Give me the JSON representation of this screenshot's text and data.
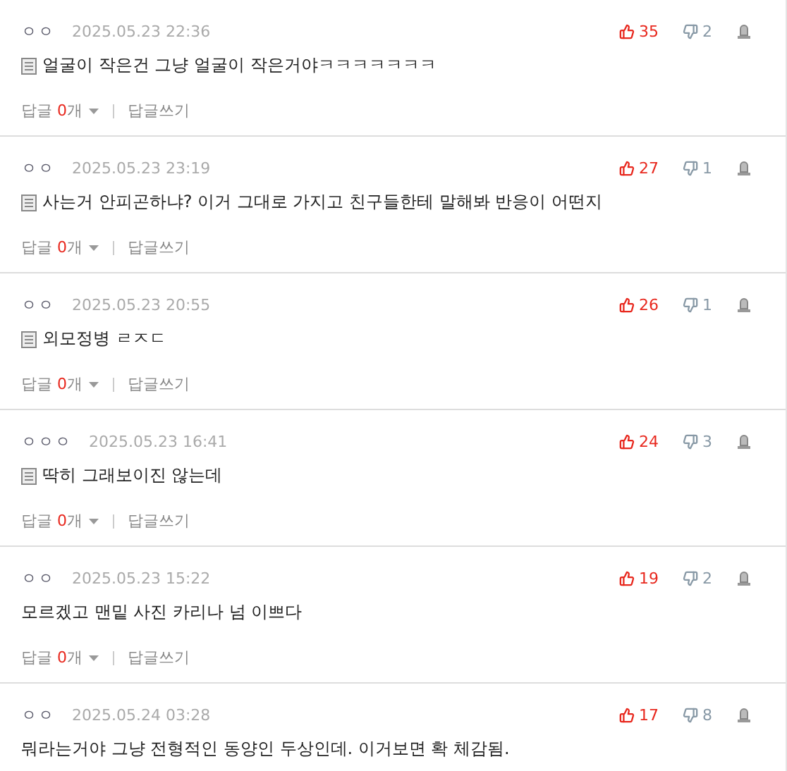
{
  "comments": [
    {
      "author": "ㅇㅇ",
      "date": "2025.05.23 22:36",
      "memo_icon": true,
      "text": "얼굴이 작은건 그냥 얼굴이 작은거야ㅋㅋㅋㅋㅋㅋㅋ",
      "likes": "35",
      "dislikes": "2",
      "reply": {
        "label": "답글",
        "count": "0",
        "unit": "개",
        "write": "답글쓰기"
      }
    },
    {
      "author": "ㅇㅇ",
      "date": "2025.05.23 23:19",
      "memo_icon": true,
      "text": "사는거 안피곤하냐? 이거 그대로 가지고 친구들한테 말해봐 반응이 어떤지",
      "likes": "27",
      "dislikes": "1",
      "reply": {
        "label": "답글",
        "count": "0",
        "unit": "개",
        "write": "답글쓰기"
      }
    },
    {
      "author": "ㅇㅇ",
      "date": "2025.05.23 20:55",
      "memo_icon": true,
      "text": "외모정병 ㄹㅈㄷ",
      "likes": "26",
      "dislikes": "1",
      "reply": {
        "label": "답글",
        "count": "0",
        "unit": "개",
        "write": "답글쓰기"
      }
    },
    {
      "author": "ㅇㅇㅇ",
      "date": "2025.05.23 16:41",
      "memo_icon": true,
      "text": "딱히 그래보이진 않는데",
      "likes": "24",
      "dislikes": "3",
      "reply": {
        "label": "답글",
        "count": "0",
        "unit": "개",
        "write": "답글쓰기"
      }
    },
    {
      "author": "ㅇㅇ",
      "date": "2025.05.23 15:22",
      "memo_icon": false,
      "text": "모르겠고 맨밑 사진 카리나 넘 이쁘다",
      "likes": "19",
      "dislikes": "2",
      "reply": {
        "label": "답글",
        "count": "0",
        "unit": "개",
        "write": "답글쓰기"
      }
    },
    {
      "author": "ㅇㅇ",
      "date": "2025.05.24 03:28",
      "memo_icon": false,
      "text": "뭐라는거야 그냥 전형적인 동양인 두상인데. 이거보면 확 체감됨.",
      "likes": "17",
      "dislikes": "8"
    }
  ]
}
